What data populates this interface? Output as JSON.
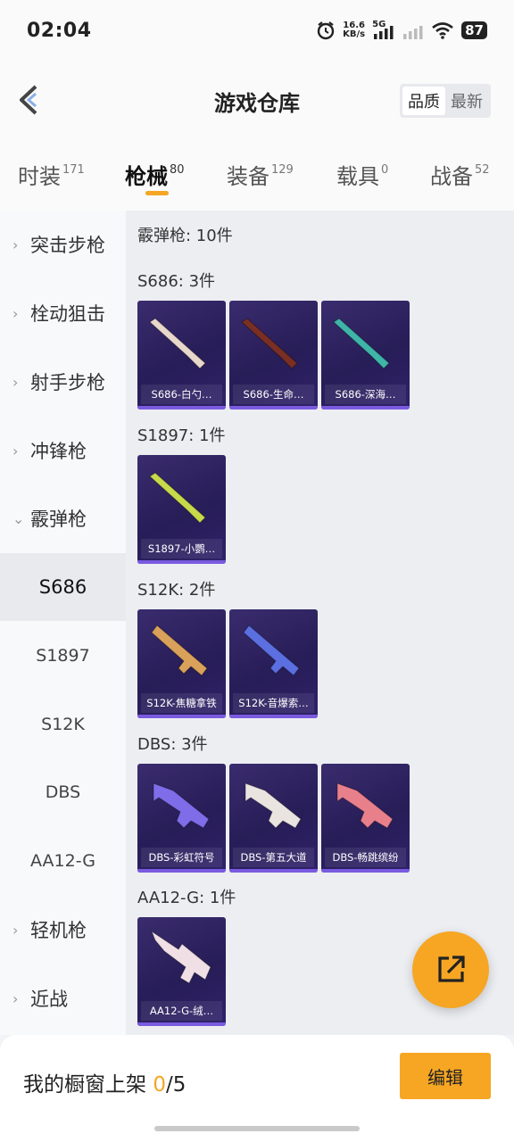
{
  "status_bar": {
    "time": "02:04",
    "net_speed_value": "16.6",
    "net_speed_unit": "KB/s",
    "network": "5G",
    "battery": "87"
  },
  "header": {
    "title": "游戏仓库",
    "sort_options": [
      "品质",
      "最新"
    ],
    "sort_selected": "品质"
  },
  "category_tabs": [
    {
      "label": "时装",
      "count": "171"
    },
    {
      "label": "枪械",
      "count": "80",
      "active": true
    },
    {
      "label": "装备",
      "count": "129"
    },
    {
      "label": "载具",
      "count": "0"
    },
    {
      "label": "战备",
      "count": "52"
    }
  ],
  "sidebar": {
    "items": [
      {
        "label": "突击步枪",
        "expandable": true
      },
      {
        "label": "栓动狙击",
        "expandable": true
      },
      {
        "label": "射手步枪",
        "expandable": true
      },
      {
        "label": "冲锋枪",
        "expandable": true
      },
      {
        "label": "霰弹枪",
        "expandable": true,
        "expanded": true
      },
      {
        "label": "S686",
        "sub": true,
        "active": true
      },
      {
        "label": "S1897",
        "sub": true
      },
      {
        "label": "S12K",
        "sub": true
      },
      {
        "label": "DBS",
        "sub": true
      },
      {
        "label": "AA12-G",
        "sub": true
      },
      {
        "label": "轻机枪",
        "expandable": true
      },
      {
        "label": "近战",
        "expandable": true
      }
    ]
  },
  "content": {
    "summary": "霰弹枪: 10件",
    "groups": [
      {
        "title": "S686: 3件",
        "items": [
          "S686-白勺…",
          "S686-生命…",
          "S686-深海…"
        ]
      },
      {
        "title": "S1897: 1件",
        "items": [
          "S1897-小鹦…"
        ]
      },
      {
        "title": "S12K: 2件",
        "items": [
          "S12K-焦糖拿铁",
          "S12K-音爆索…"
        ]
      },
      {
        "title": "DBS: 3件",
        "items": [
          "DBS-彩虹符号",
          "DBS-第五大道",
          "DBS-畅跳缤纷"
        ]
      },
      {
        "title": "AA12-G: 1件",
        "items": [
          "AA12-G-绒…"
        ]
      }
    ]
  },
  "skin_colors": [
    "#e8d8cc",
    "#7a2f24",
    "#3fb5a8",
    "#c8d94a",
    "#d9a15a",
    "#5b6fe0",
    "#7f6ce8",
    "#e9e4e0",
    "#e8808c",
    "#f0dfe4"
  ],
  "footer": {
    "showcase_label": "我的橱窗上架",
    "showcase_count": "0",
    "showcase_total": "/5",
    "edit_label": "编辑"
  },
  "colors": {
    "accent": "#f6a623",
    "card_bg": "#2c2160"
  },
  "icons": {
    "back": "back-arrow-icon",
    "fab": "share-export-icon",
    "chevron": "chevron-right-icon"
  }
}
